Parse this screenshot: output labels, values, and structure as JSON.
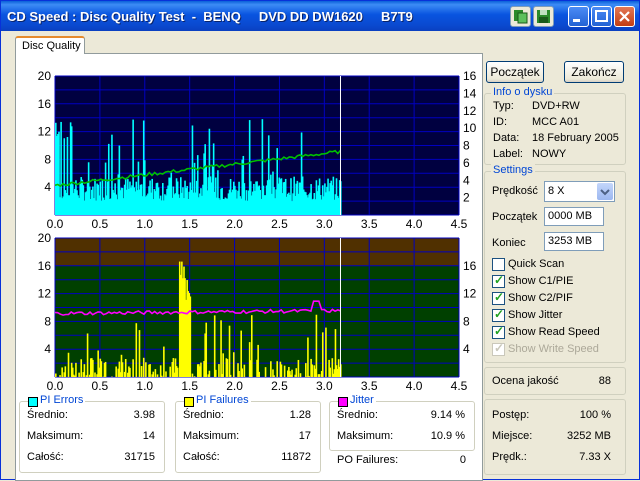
{
  "window": {
    "title": "CD Speed : Disc Quality Test  -  BENQ     DVD DD DW1620     B7T9",
    "tab": "Disc Quality"
  },
  "buttons": {
    "start": "Początek",
    "quit": "Zakończ"
  },
  "disc_info": {
    "title": "Info o dysku",
    "rows": [
      {
        "label": "Typ:",
        "value": "DVD+RW"
      },
      {
        "label": "ID:",
        "value": "MCC A01"
      },
      {
        "label": "Data:",
        "value": "18 February 2005"
      },
      {
        "label": "Label:",
        "value": "NOWY"
      }
    ]
  },
  "settings": {
    "title": "Settings",
    "speed_label": "Prędkość",
    "speed_value": "8 X",
    "start_label": "Początek",
    "start_value": "0000 MB",
    "end_label": "Koniec",
    "end_value": "3253 MB",
    "checks": [
      {
        "label": "Quick Scan",
        "checked": false,
        "disabled": false
      },
      {
        "label": "Show C1/PIE",
        "checked": true,
        "disabled": false
      },
      {
        "label": "Show C2/PIF",
        "checked": true,
        "disabled": false
      },
      {
        "label": "Show Jitter",
        "checked": true,
        "disabled": false
      },
      {
        "label": "Show Read Speed",
        "checked": true,
        "disabled": false
      },
      {
        "label": "Show Write Speed",
        "checked": true,
        "disabled": true
      }
    ]
  },
  "quality": {
    "label": "Ocena jakość",
    "value": "88"
  },
  "progress": {
    "rows": [
      {
        "label": "Postęp:",
        "value": "100 %"
      },
      {
        "label": "Miejsce:",
        "value": "3252 MB"
      },
      {
        "label": "Prędk.:",
        "value": "7.33 X"
      }
    ]
  },
  "pi_errors": {
    "title": "PI Errors",
    "color": "#00ffff",
    "rows": [
      {
        "label": "Średnio:",
        "value": "3.98"
      },
      {
        "label": "Maksimum:",
        "value": "14"
      },
      {
        "label": "Całość:",
        "value": "31715"
      }
    ]
  },
  "pi_failures": {
    "title": "PI Failures",
    "color": "#ffff00",
    "rows": [
      {
        "label": "Średnio:",
        "value": "1.28"
      },
      {
        "label": "Maksimum:",
        "value": "17"
      },
      {
        "label": "Całość:",
        "value": "11872"
      }
    ]
  },
  "jitter": {
    "title": "Jitter",
    "color": "#ff00ff",
    "rows": [
      {
        "label": "Średnio:",
        "value": "9.14 %"
      },
      {
        "label": "Maksimum:",
        "value": "10.9 %"
      }
    ]
  },
  "po_failures": {
    "label": "PO Failures:",
    "value": "0"
  },
  "chart_data": [
    {
      "type": "bar",
      "x_ticks": [
        "0.0",
        "0.5",
        "1.0",
        "1.5",
        "2.0",
        "2.5",
        "3.0",
        "3.5",
        "4.0",
        "4.5"
      ],
      "y_left_ticks": [
        "20",
        "16",
        "12",
        "8",
        "4"
      ],
      "y_right_ticks": [
        "16",
        "14",
        "12",
        "10",
        "8",
        "6",
        "4",
        "2"
      ],
      "xlim": [
        0,
        4.5
      ],
      "ylim_left": [
        0,
        20
      ],
      "ylim_right": [
        0,
        16
      ],
      "scan_end": 3.18,
      "series": [
        {
          "name": "PI Errors",
          "color": "#00ffff",
          "mean": 3.98,
          "max": 14
        },
        {
          "name": "Read Speed",
          "color": "#00c000",
          "type": "line",
          "x": [
            0.0,
            3.18
          ],
          "y": [
            3.4,
            7.3
          ]
        }
      ],
      "colors": {
        "background": "#000040",
        "grid": "#0000c0"
      }
    },
    {
      "type": "bar",
      "x_ticks": [
        "0.0",
        "0.5",
        "1.0",
        "1.5",
        "2.0",
        "2.5",
        "3.0",
        "3.5",
        "4.0",
        "4.5"
      ],
      "y_left_ticks": [
        "20",
        "16",
        "12",
        "8",
        "4"
      ],
      "y_right_ticks": [
        "16",
        "12",
        "8",
        "4"
      ],
      "xlim": [
        0,
        4.5
      ],
      "ylim_left": [
        0,
        20
      ],
      "ylim_right": [
        0,
        20
      ],
      "scan_end": 3.18,
      "series": [
        {
          "name": "PI Failures",
          "color": "#ffff00",
          "mean": 1.28,
          "max": 17
        },
        {
          "name": "Jitter",
          "color": "#ff00ff",
          "type": "line",
          "mean": 9.14,
          "max": 10.9
        }
      ],
      "colors": {
        "upper_band": "#503000",
        "lower_band": "#004000",
        "grid": "#0000c0"
      }
    }
  ]
}
